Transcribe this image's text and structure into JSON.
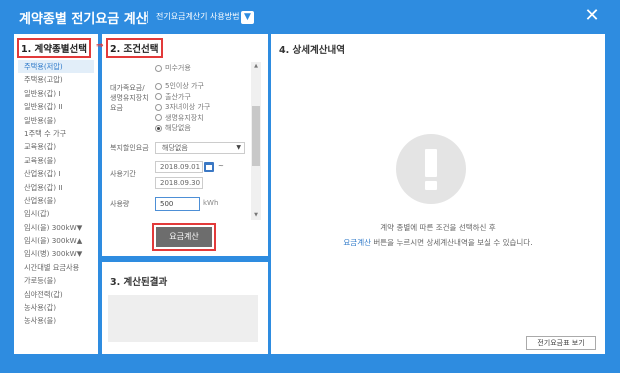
{
  "header": {
    "title": "계약종별 전기요금 계산",
    "howto_label": "전기요금계산기 사용방법",
    "howto_icon": "chevron-down-icon",
    "close_icon": "close-icon"
  },
  "step1": {
    "label": "1. 계약종별선택",
    "items": [
      {
        "label": "주택용(저압)",
        "active": true
      },
      {
        "label": "주택용(고압)",
        "active": false
      },
      {
        "label": "일반용(갑) I",
        "active": false
      },
      {
        "label": "일반용(갑) II",
        "active": false
      },
      {
        "label": "일반용(을)",
        "active": false
      },
      {
        "label": "1주택 수 가구",
        "active": false
      },
      {
        "label": "교육용(갑)",
        "active": false
      },
      {
        "label": "교육용(을)",
        "active": false
      },
      {
        "label": "산업용(갑) I",
        "active": false
      },
      {
        "label": "산업용(갑) II",
        "active": false
      },
      {
        "label": "산업용(을)",
        "active": false
      },
      {
        "label": "임시(갑)",
        "active": false
      },
      {
        "label": "임시(을) 300kW▼",
        "active": false
      },
      {
        "label": "임시(을) 300kW▲",
        "active": false
      },
      {
        "label": "임시(병) 300kW▼",
        "active": false
      },
      {
        "label": "시간대별 요금사용",
        "active": false
      },
      {
        "label": "가로등(을)",
        "active": false
      },
      {
        "label": "심야전력(갑)",
        "active": false
      },
      {
        "label": "농사용(갑)",
        "active": false
      },
      {
        "label": "농사용(을)",
        "active": false
      }
    ]
  },
  "step2": {
    "label": "2. 조건선택",
    "partial_top_option": "미수거용",
    "discount_label": "대가족요금/ 생명유지장치 요금",
    "radio_options": [
      {
        "label": "5인이상 가구",
        "checked": false
      },
      {
        "label": "출산가구",
        "checked": false
      },
      {
        "label": "3자녀이상 가구",
        "checked": false
      },
      {
        "label": "생명유지장치",
        "checked": false
      },
      {
        "label": "해당없음",
        "checked": true
      }
    ],
    "welfare_label": "복지할인요금",
    "welfare_value": "해당없음",
    "period_label": "사용기간",
    "period_start": "2018.09.01",
    "period_end": "2018.09.30",
    "tilde": "~",
    "usage_label": "사용량",
    "usage_value": "500",
    "usage_unit": "kWh",
    "calc_button": "요금계산"
  },
  "step3": {
    "label": "3. 계산된결과"
  },
  "step4": {
    "label": "4. 상세계산내역",
    "message_line1": "계약 종별에 따른 조건을 선택하신 후",
    "message_highlight": "요금계산",
    "message_line2_rest": " 버튼을 누르시면 상세계산내역을 보실 수 있습니다.",
    "info_icon": "exclamation-icon",
    "rate_table_button": "전기요금표 보기"
  },
  "colors": {
    "accent": "#2e8ce0",
    "highlight_border": "#e23a3a",
    "calc_button_bg": "#6d6d6d"
  }
}
